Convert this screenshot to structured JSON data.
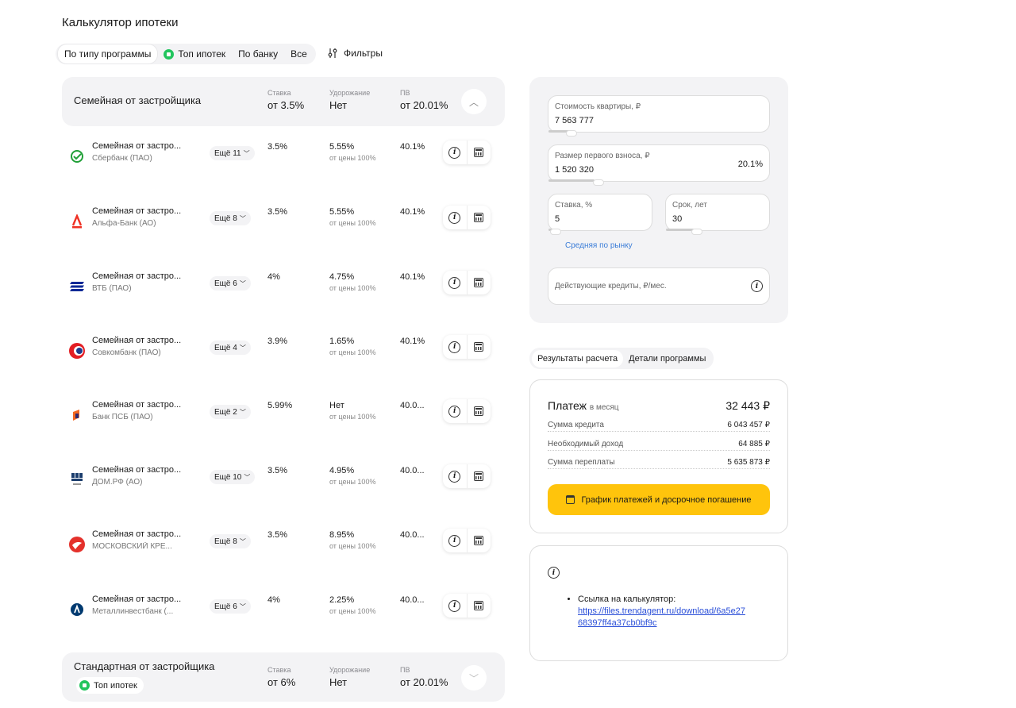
{
  "title": "Калькулятор ипотеки",
  "tabs": [
    {
      "label": "По типу программы",
      "active": true
    },
    {
      "label": "Топ ипотек",
      "icon": "top-badge-icon"
    },
    {
      "label": "По банку"
    },
    {
      "label": "Все"
    }
  ],
  "filters_label": "Фильтры",
  "group1": {
    "name": "Семейная от застройщика",
    "rate_caption": "Ставка",
    "rate": "от 3.5%",
    "increase_caption": "Удорожание",
    "increase": "Нет",
    "pv_caption": "ПВ",
    "pv": "от 20.01%"
  },
  "rows": [
    {
      "name": "Семейная от застро...",
      "bank": "Сбербанк (ПАО)",
      "more": "Ещё 11",
      "rate": "3.5%",
      "inc": "5.55%",
      "inc_sub": "от цены 100%",
      "pv": "40.1%",
      "logo": "sber-logo-icon",
      "color": "#21a038"
    },
    {
      "name": "Семейная от застро...",
      "bank": "Альфа-Банк (АО)",
      "more": "Ещё 8",
      "rate": "3.5%",
      "inc": "5.55%",
      "inc_sub": "от цены 100%",
      "pv": "40.1%",
      "logo": "alfa-logo-icon",
      "color": "#ef3124"
    },
    {
      "name": "Семейная от застро...",
      "bank": "ВТБ (ПАО)",
      "more": "Ещё 6",
      "rate": "4%",
      "inc": "4.75%",
      "inc_sub": "от цены 100%",
      "pv": "40.1%",
      "logo": "vtb-logo-icon",
      "color": "#0a2896"
    },
    {
      "name": "Семейная от застро...",
      "bank": "Совкомбанк (ПАО)",
      "more": "Ещё 4",
      "rate": "3.9%",
      "inc": "1.65%",
      "inc_sub": "от цены 100%",
      "pv": "40.1%",
      "logo": "sovcom-logo-icon",
      "color": "#e31e24"
    },
    {
      "name": "Семейная от застро...",
      "bank": "Банк ПСБ (ПАО)",
      "more": "Ещё 2",
      "rate": "5.99%",
      "inc": "Нет",
      "inc_sub": "от цены 100%",
      "pv": "40.0...",
      "logo": "psb-logo-icon",
      "color": "#f26722"
    },
    {
      "name": "Семейная от застро...",
      "bank": "ДОМ.РФ (АО)",
      "more": "Ещё 10",
      "rate": "3.5%",
      "inc": "4.95%",
      "inc_sub": "от цены 100%",
      "pv": "40.0...",
      "logo": "domrf-logo-icon",
      "color": "#1b3d6d"
    },
    {
      "name": "Семейная от застро...",
      "bank": "МОСКОВСКИЙ КРЕ...",
      "more": "Ещё 8",
      "rate": "3.5%",
      "inc": "8.95%",
      "inc_sub": "от цены 100%",
      "pv": "40.0...",
      "logo": "mkb-logo-icon",
      "color": "#e4312b"
    },
    {
      "name": "Семейная от застро...",
      "bank": "Металлинвестбанк (...",
      "more": "Ещё 6",
      "rate": "4%",
      "inc": "2.25%",
      "inc_sub": "от цены 100%",
      "pv": "40.0...",
      "logo": "metallinvest-logo-icon",
      "color": "#003a70"
    }
  ],
  "group2": {
    "name": "Стандартная от застройщика",
    "tag": "Топ ипотек",
    "rate_caption": "Ставка",
    "rate": "от 6%",
    "increase_caption": "Удорожание",
    "increase": "Нет",
    "pv_caption": "ПВ",
    "pv": "от 20.01%"
  },
  "calc": {
    "price_label": "Стоимость квартиры, ₽",
    "price": "7 563 777",
    "down_label": "Размер первого взноса, ₽",
    "down": "1 520 320",
    "down_pct": "20.1%",
    "rate_label": "Ставка, %",
    "rate": "5",
    "term_label": "Срок, лет",
    "term": "30",
    "avg_link": "Средняя по рынку",
    "credits_placeholder": "Действующие кредиты, ₽/мес."
  },
  "result_tabs": [
    {
      "label": "Результаты расчета",
      "active": true
    },
    {
      "label": "Детали программы"
    }
  ],
  "result": {
    "payment_label": "Платеж",
    "payment_sub": "в месяц",
    "payment": "32 443 ₽",
    "lines": [
      {
        "label": "Сумма кредита",
        "value": "6 043 457 ₽"
      },
      {
        "label": "Необходимый доход",
        "value": "64 885 ₽"
      },
      {
        "label": "Сумма переплаты",
        "value": "5 635 873 ₽"
      }
    ],
    "schedule_button": "График платежей и досрочное погашение"
  },
  "info": {
    "link_label": "Ссылка на калькулятор:",
    "link": "https://files.trendagent.ru/download/6a5e2768397ff4a37cb0bf9c"
  },
  "colors": {
    "accent": "#ffc40c",
    "link": "#3b7dd8",
    "top": "#22c55e"
  }
}
